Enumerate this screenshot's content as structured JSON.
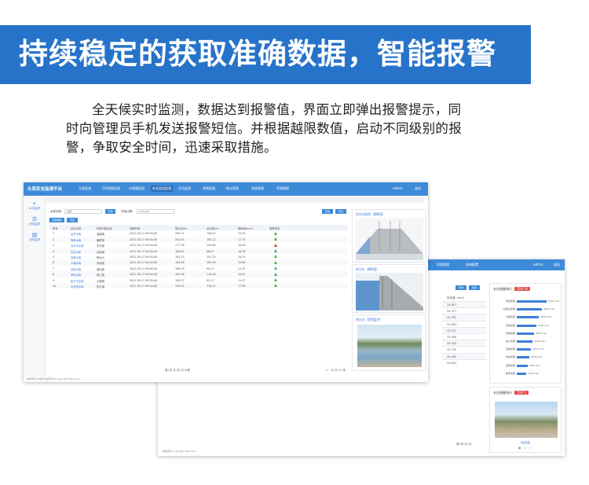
{
  "banner": {
    "title": "持续稳定的获取准确数据，智能报警",
    "color": "#2673c9"
  },
  "intro": {
    "line1": "全天候实时监测，数据达到报警值，界面立即弹出报警提示，同",
    "line2": "时向管理员手机发送报警短信。并根据越限数值，启动不同级别的报",
    "line3": "警，争取安全时间，迅速采取措施。"
  },
  "back_screen": {
    "nav": [
      "资源管理",
      "系统配置"
    ],
    "user": "admin",
    "exit": "退出",
    "buttons": [
      "查询",
      "导出"
    ],
    "table_header": "安全值（mm）",
    "rows": [
      "34.827",
      "34.377",
      "34.781",
      "33.823",
      "33.372",
      "33.490",
      "35.420",
      "35.730",
      "34.495",
      "34.824"
    ],
    "rank1": {
      "title": "水位隐患排行",
      "tag": "TOP 10",
      "items": [
        {
          "name": "青龙水库",
          "value": 0.95,
          "label": "5000 mm"
        },
        {
          "name": "红岭山水库",
          "value": 0.8,
          "label": "4000 mm"
        },
        {
          "name": "大塘水库",
          "value": 0.7,
          "label": "3500 mm"
        },
        {
          "name": "双溪水库",
          "value": 0.62,
          "label": "3100 mm"
        },
        {
          "name": "石峡水库",
          "value": 0.55,
          "label": "2800 mm"
        },
        {
          "name": "白沙水库",
          "value": 0.5,
          "label": "2500 mm"
        },
        {
          "name": "高峰水库",
          "value": 0.46,
          "label": "2300 mm"
        },
        {
          "name": "长岭水库",
          "value": 0.4,
          "label": "2000 mm"
        },
        {
          "name": "龙潭水库",
          "value": 0.34,
          "label": "1700 mm"
        },
        {
          "name": "新丰水库",
          "value": 0.3,
          "label": "1500 mm"
        }
      ]
    },
    "rank2": {
      "title": "水位隐患排行",
      "tag": "TOP 5",
      "caption": "监控画面"
    },
    "pager": "第1页 共1页",
    "footer": "版权所有 Copyright Reserved"
  },
  "front_screen": {
    "app_title": "水库安全监测平台",
    "nav": [
      "大屏监测",
      "GIS地图监测",
      "水雨情监测",
      "安全监测监测",
      "水位监测",
      "视频监测",
      "统计报表",
      "系统管理",
      "资源管理"
    ],
    "user": "admin",
    "exit": "退出",
    "sidebar": [
      {
        "icon": "⌖",
        "label": "水位监测"
      },
      {
        "icon": "☰",
        "label": "渗流监测"
      },
      {
        "icon": "▤",
        "label": "变形监测"
      }
    ],
    "filter": {
      "label1": "水库名称：",
      "placeholder1": "全部",
      "btn1": "查询",
      "label2": "开始日期：",
      "value2": "2021-09",
      "btn_query": "查询",
      "btn_export": "导出"
    },
    "actions": [
      "批量删除",
      "导出"
    ],
    "columns": [
      "序号",
      "站点名称",
      "所属行政区划",
      "采集时间",
      "库水位(m)",
      "水位差(m)",
      "降雨量(mm)",
      "报警状态"
    ],
    "rows": [
      [
        "1",
        "龙华水库",
        "温塘镇",
        "2021-09-17 09:00:00",
        "200.74",
        "158.02",
        "25.03",
        "ok"
      ],
      [
        "2",
        "梅林水库",
        "塘厦镇",
        "2021-09-17 09:00:00",
        "205.63",
        "163.22",
        "17.33",
        "ok"
      ],
      [
        "3",
        "清水河水库",
        "东坑镇",
        "2021-09-17 09:00:00",
        "177.76",
        "154.80",
        "18.06",
        "alarm"
      ],
      [
        "4",
        "石岩水库",
        "清溪镇",
        "2021-09-17 09:00:00",
        "184.02",
        "86.07",
        "16.76",
        "ok"
      ],
      [
        "5",
        "西丽水库",
        "樟木头",
        "2021-09-17 09:00:00",
        "182.23",
        "152.33",
        "16.70",
        "ok"
      ],
      [
        "6",
        "大塘水库",
        "凤岗镇",
        "2021-09-17 09:00:00",
        "184.06",
        "162.46",
        "15.60",
        "ok"
      ],
      [
        "7",
        "铁岗水库",
        "谢岗镇",
        "2021-09-17 09:00:00",
        "186.10",
        "90.21",
        "14.30",
        "ok"
      ],
      [
        "8",
        "罗田水库",
        "黄江镇",
        "2021-09-17 09:00:00",
        "204.06",
        "110.08",
        "16.02",
        "ok"
      ],
      [
        "9",
        "松子坑水库",
        "大朗镇",
        "2021-09-17 09:00:00",
        "180.27",
        "92.17",
        "15.37",
        "ok"
      ],
      [
        "10",
        "长岭皮水库",
        "常平镇",
        "2021-09-17 09:00:00",
        "220.20",
        "118.41",
        "17.58",
        "ok"
      ]
    ],
    "panels": [
      "库水位曲线（横断面）",
      "库水位（横断面）",
      "库水位（视频监控）"
    ],
    "pager": "第1页 共1页 共10条",
    "pager_right": "1 - 10 共 10 条",
    "footer": "版权所有 水库安全监测平台 Copyright Reserved"
  }
}
